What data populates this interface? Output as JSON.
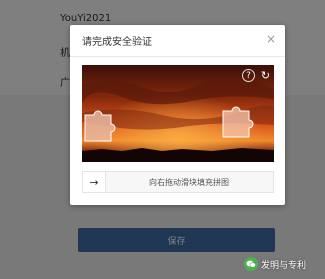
{
  "page": {
    "fields": [
      "YouYi2021",
      "机构账号",
      "广东友易"
    ],
    "save_label": "保存"
  },
  "dialog": {
    "title": "请完成安全验证",
    "close_icon": "close-icon",
    "help_icon": "help-icon",
    "refresh_icon": "refresh-icon",
    "slider_handle_icon": "arrow-right-icon",
    "slider_hint": "向右拖动滑块填充拼图"
  },
  "watermark": {
    "text": "发明与专利"
  },
  "colors": {
    "primary": "#3e6fa6",
    "overlay": "rgba(0,0,0,0.5)"
  }
}
